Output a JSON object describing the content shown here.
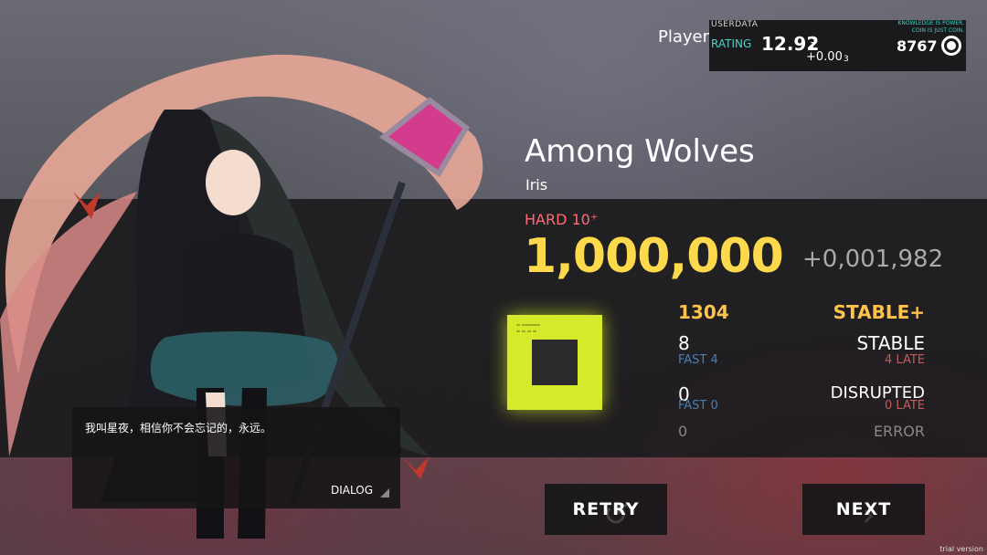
{
  "header": {
    "player_name": "Player",
    "userdata_label": "USERDATA",
    "note_line1": "KNOWLEDGE IS POWER.",
    "note_line2": "COIN IS JUST COIN.",
    "rating_label": "RATING",
    "rating_value": "12.92",
    "rating_sub": "1",
    "rating_delta": "+0.00",
    "rating_delta_sub": "3",
    "coins": "8767",
    "coin_icon": "coin-icon"
  },
  "song": {
    "title": "Among Wolves",
    "artist": "Iris",
    "difficulty": "HARD 10⁺",
    "score": "1,000,000",
    "score_delta": "+0,001,982"
  },
  "grade": {
    "icon": "grade-square-icon",
    "color": "#d4ea2a"
  },
  "stats": {
    "col1": {
      "total": "1304",
      "judge1": "8",
      "judge1_fast": "FAST 4",
      "judge2": "0",
      "judge2_fast": "FAST 0",
      "judge3": "0"
    },
    "col2": {
      "total_label": "STABLE+",
      "judge1_label": "STABLE",
      "judge1_late": "4 LATE",
      "judge2_label": "DISRUPTED",
      "judge2_late": "0 LATE",
      "judge3_label": "ERROR"
    }
  },
  "dialog": {
    "text": "我叫星夜，相信你不会忘记的，永远。",
    "label": "DIALOG"
  },
  "buttons": {
    "retry": "RETRY",
    "next": "NEXT"
  },
  "footer": {
    "trial": "trial version"
  },
  "colors": {
    "gold": "#ffd94c",
    "accent_red": "#ff6b73",
    "teal": "#4dd2c8"
  }
}
